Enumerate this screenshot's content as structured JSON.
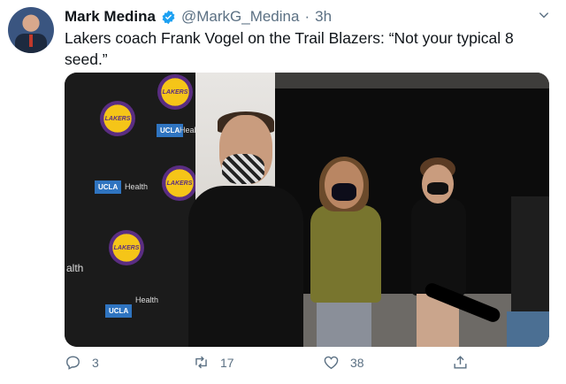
{
  "tweet": {
    "author_name": "Mark Medina",
    "handle": "@MarkG_Medina",
    "separator": "·",
    "time": "3h",
    "text": "Lakers coach Frank Vogel on the Trail Blazers: “Not your typical 8 seed.”"
  },
  "media": {
    "backdrop_logos": [
      "LAKERS",
      "LAKERS",
      "LAKERS",
      "LAKERS"
    ],
    "backdrop_sponsor": "UCLA",
    "backdrop_sponsor_sub": "Health",
    "backdrop_fragment": "alth"
  },
  "actions": {
    "reply_count": "3",
    "retweet_count": "17",
    "like_count": "38"
  },
  "colors": {
    "verified": "#1da1f2",
    "secondary_text": "#5b7083",
    "lakers_gold": "#f5c518",
    "lakers_purple": "#5a2d82"
  },
  "icons": [
    "verified-badge-icon",
    "chevron-down-icon",
    "reply-icon",
    "retweet-icon",
    "like-icon",
    "share-icon"
  ]
}
